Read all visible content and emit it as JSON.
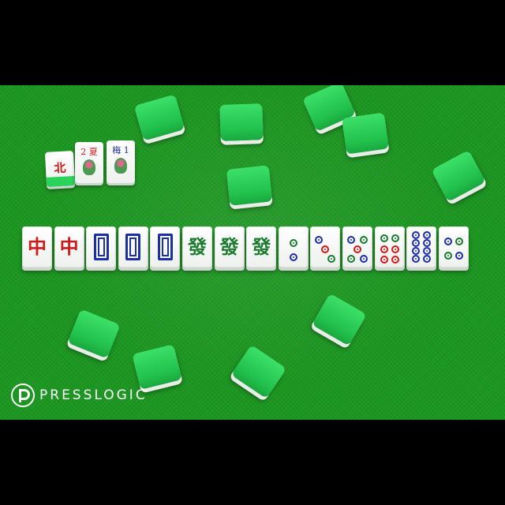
{
  "brand": {
    "name": "PRESSLOGIC"
  },
  "bonus_tiles": [
    {
      "chars": "北",
      "color": "#d01919"
    },
    {
      "chars": "2 夏",
      "color": "#d01919"
    },
    {
      "chars": "梅 1",
      "color": "#1c2fa5"
    }
  ],
  "hand": [
    {
      "kind": "red-dragon",
      "text": "中"
    },
    {
      "kind": "red-dragon",
      "text": "中"
    },
    {
      "kind": "white-dragon",
      "text": ""
    },
    {
      "kind": "white-dragon",
      "text": ""
    },
    {
      "kind": "white-dragon",
      "text": ""
    },
    {
      "kind": "green-dragon",
      "text": "發"
    },
    {
      "kind": "green-dragon",
      "text": "發"
    },
    {
      "kind": "green-dragon",
      "text": "發"
    },
    {
      "kind": "circles",
      "count": 2
    },
    {
      "kind": "circles",
      "count": 3
    },
    {
      "kind": "circles",
      "count": 5
    },
    {
      "kind": "circles",
      "count": 6
    },
    {
      "kind": "circles",
      "count": 8
    },
    {
      "kind": "circles",
      "count": 4
    }
  ],
  "colors": {
    "felt": "#1f9a24",
    "tile_back": "#22c24d",
    "red": "#d01919",
    "green": "#1a7a2e",
    "blue": "#1c2fa5"
  }
}
